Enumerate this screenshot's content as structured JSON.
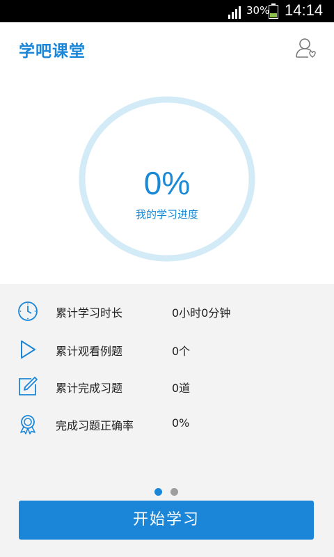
{
  "statusbar": {
    "battery": "30%",
    "time": "14:14"
  },
  "header": {
    "title": "学吧课堂"
  },
  "progress": {
    "percent_text": "0%",
    "label": "我的学习进度",
    "value": 0
  },
  "stats": [
    {
      "icon": "clock-icon",
      "label": "累计学习时长",
      "value": "0小时0分钟"
    },
    {
      "icon": "play-icon",
      "label": "累计观看例题",
      "value": "0个"
    },
    {
      "icon": "pencil-edit-icon",
      "label": "累计完成习题",
      "value": "0道"
    },
    {
      "icon": "award-badge-icon",
      "label": "完成习题正确率",
      "value": "0%"
    }
  ],
  "pager": {
    "count": 2,
    "active": 0
  },
  "actions": {
    "start_label": "开始学习"
  },
  "colors": {
    "accent": "#1b86d8",
    "ring": "#d3ebf7",
    "stats_bg": "#f3f3f3"
  }
}
